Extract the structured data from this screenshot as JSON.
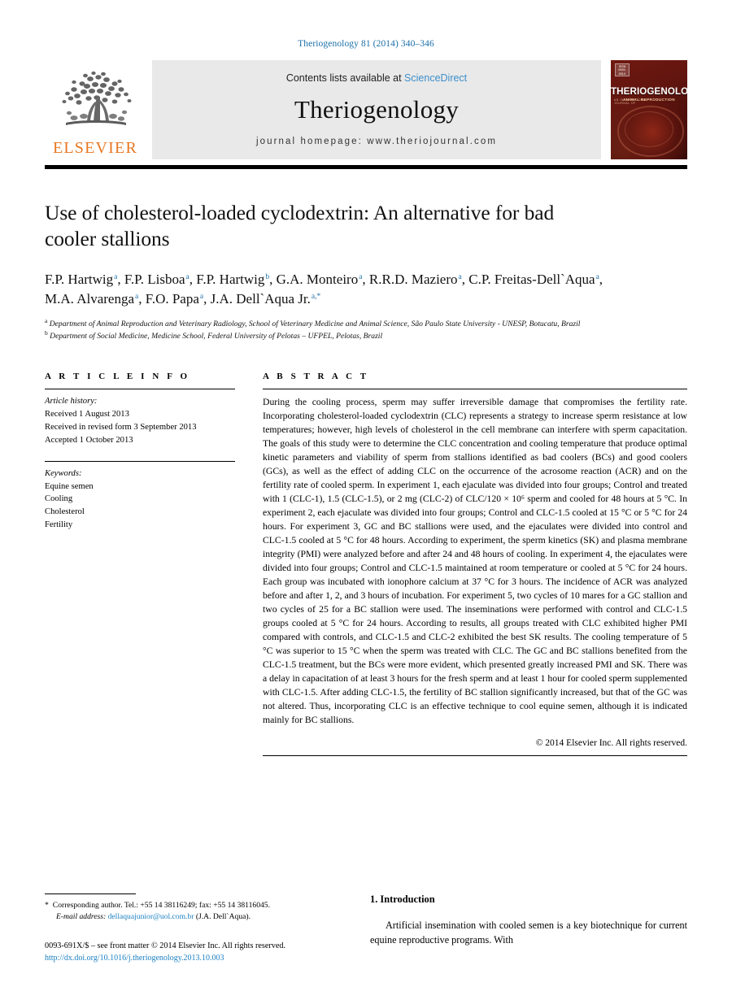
{
  "running_head": "Theriogenology 81 (2014) 340–346",
  "masthead": {
    "publisher_logo_text": "ELSEVIER",
    "contents_prefix": "Contents lists available at ",
    "sciencedirect": "ScienceDirect",
    "journal_name": "Theriogenology",
    "homepage": "journal homepage: www.theriojournal.com",
    "cover": {
      "title": "THERIOGENOLOGY",
      "subtitle": "ANIMAL REPRODUCTION",
      "side_text": "AN INTERNATIONAL JOURNAL OF",
      "corner_badge": "ISSN 0093-691X",
      "accent_color": "#6a1710"
    },
    "link_color": "#3c8ecb"
  },
  "article": {
    "title": "Use of cholesterol-loaded cyclodextrin: An alternative for bad cooler stallions",
    "authors": [
      {
        "name": "F.P. Hartwig",
        "marks": "a",
        "sep": ", "
      },
      {
        "name": "F.P. Lisboa",
        "marks": "a",
        "sep": ", "
      },
      {
        "name": "F.P. Hartwig",
        "marks": "b",
        "sep": ", "
      },
      {
        "name": "G.A. Monteiro",
        "marks": "a",
        "sep": ", "
      },
      {
        "name": "R.R.D. Maziero",
        "marks": "a",
        "sep": ", "
      },
      {
        "name": "C.P. Freitas-Dell`Aqua",
        "marks": "a",
        "sep": ", "
      },
      {
        "name": "M.A. Alvarenga",
        "marks": "a",
        "sep": ", "
      },
      {
        "name": "F.O. Papa",
        "marks": "a",
        "sep": ", "
      },
      {
        "name": "J.A. Dell`Aqua Jr.",
        "marks": "a,*",
        "sep": ""
      }
    ],
    "affiliations": [
      {
        "mark": "a",
        "text": "Department of Animal Reproduction and Veterinary Radiology, School of Veterinary Medicine and Animal Science, São Paulo State University - UNESP, Botucatu, Brazil"
      },
      {
        "mark": "b",
        "text": "Department of Social Medicine, Medicine School, Federal University of Pelotas – UFPEL, Pelotas, Brazil"
      }
    ]
  },
  "article_info": {
    "heading": "A R T I C L E   I N F O",
    "history_label": "Article history:",
    "history": [
      "Received 1 August 2013",
      "Received in revised form 3 September 2013",
      "Accepted 1 October 2013"
    ],
    "keywords_label": "Keywords:",
    "keywords": [
      "Equine semen",
      "Cooling",
      "Cholesterol",
      "Fertility"
    ]
  },
  "abstract": {
    "heading": "A B S T R A C T",
    "text": "During the cooling process, sperm may suffer irreversible damage that compromises the fertility rate. Incorporating cholesterol-loaded cyclodextrin (CLC) represents a strategy to increase sperm resistance at low temperatures; however, high levels of cholesterol in the cell membrane can interfere with sperm capacitation. The goals of this study were to determine the CLC concentration and cooling temperature that produce optimal kinetic parameters and viability of sperm from stallions identified as bad coolers (BCs) and good coolers (GCs), as well as the effect of adding CLC on the occurrence of the acrosome reaction (ACR) and on the fertility rate of cooled sperm. In experiment 1, each ejaculate was divided into four groups; Control and treated with 1 (CLC-1), 1.5 (CLC-1.5), or 2 mg (CLC-2) of CLC/120 × 10⁶ sperm and cooled for 48 hours at 5 °C. In experiment 2, each ejaculate was divided into four groups; Control and CLC-1.5 cooled at 15 °C or 5 °C for 24 hours. For experiment 3, GC and BC stallions were used, and the ejaculates were divided into control and CLC-1.5 cooled at 5 °C for 48 hours. According to experiment, the sperm kinetics (SK) and plasma membrane integrity (PMI) were analyzed before and after 24 and 48 hours of cooling. In experiment 4, the ejaculates were divided into four groups; Control and CLC-1.5 maintained at room temperature or cooled at 5 °C for 24 hours. Each group was incubated with ionophore calcium at 37 °C for 3 hours. The incidence of ACR was analyzed before and after 1, 2, and 3 hours of incubation. For experiment 5, two cycles of 10 mares for a GC stallion and two cycles of 25 for a BC stallion were used. The inseminations were performed with control and CLC-1.5 groups cooled at 5 °C for 24 hours. According to results, all groups treated with CLC exhibited higher PMI compared with controls, and CLC-1.5 and CLC-2 exhibited the best SK results. The cooling temperature of 5 °C was superior to 15 °C when the sperm was treated with CLC. The GC and BC stallions benefited from the CLC-1.5 treatment, but the BCs were more evident, which presented greatly increased PMI and SK. There was a delay in capacitation of at least 3 hours for the fresh sperm and at least 1 hour for cooled sperm supplemented with CLC-1.5. After adding CLC-1.5, the fertility of BC stallion significantly increased, but that of the GC was not altered. Thus, incorporating CLC is an effective technique to cool equine semen, although it is indicated mainly for BC stallions.",
    "copyright": "© 2014 Elsevier Inc. All rights reserved."
  },
  "footer": {
    "star": "*",
    "corresponding": "Corresponding author. Tel.: +55 14 38116249; fax: +55 14 38116045.",
    "email_label": "E-mail address:",
    "email": "dellaquajunior@uol.com.br",
    "email_owner": "(J.A. Dell`Aqua).",
    "issn_line": "0093-691X/$ – see front matter © 2014 Elsevier Inc. All rights reserved.",
    "doi": "http://dx.doi.org/10.1016/j.theriogenology.2013.10.003",
    "link_color": "#1a7fc1"
  },
  "introduction": {
    "heading": "1. Introduction",
    "paragraph": "Artificial insemination with cooled semen is a key biotechnique for current equine reproductive programs. With"
  }
}
